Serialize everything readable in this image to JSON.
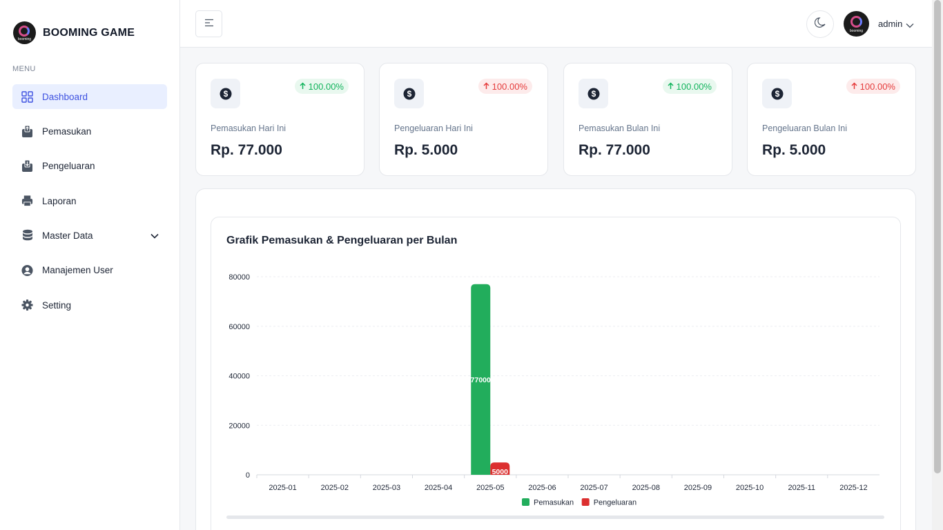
{
  "brand": {
    "name": "BOOMING GAME",
    "logo_text": "booming"
  },
  "sidebar": {
    "menu_title": "MENU",
    "items": [
      {
        "label": "Dashboard",
        "icon": "grid-icon",
        "active": true
      },
      {
        "label": "Pemasukan",
        "icon": "upload-box-icon"
      },
      {
        "label": "Pengeluaran",
        "icon": "download-box-icon"
      },
      {
        "label": "Laporan",
        "icon": "printer-icon"
      },
      {
        "label": "Master Data",
        "icon": "database-icon",
        "expandable": true
      },
      {
        "label": "Manajemen User",
        "icon": "user-circle-icon"
      },
      {
        "label": "Setting",
        "icon": "gear-icon"
      }
    ]
  },
  "header": {
    "user_name": "admin",
    "avatar_text": "booming"
  },
  "cards": [
    {
      "label": "Pemasukan Hari Ini",
      "value": "Rp. 77.000",
      "change": "100.00%",
      "trend": "up"
    },
    {
      "label": "Pengeluaran Hari Ini",
      "value": "Rp. 5.000",
      "change": "100.00%",
      "trend": "down"
    },
    {
      "label": "Pemasukan Bulan Ini",
      "value": "Rp. 77.000",
      "change": "100.00%",
      "trend": "up"
    },
    {
      "label": "Pengeluaran Bulan Ini",
      "value": "Rp. 5.000",
      "change": "100.00%",
      "trend": "down"
    }
  ],
  "colors": {
    "accent": "#3c50e0",
    "income": "#22ad5c",
    "expense": "#dc3030",
    "up": "#10b35b",
    "down": "#e53b3b"
  },
  "chart_data": {
    "type": "bar",
    "title": "Grafik Pemasukan & Pengeluaran per Bulan",
    "categories": [
      "2025-01",
      "2025-02",
      "2025-03",
      "2025-04",
      "2025-05",
      "2025-06",
      "2025-07",
      "2025-08",
      "2025-09",
      "2025-10",
      "2025-11",
      "2025-12"
    ],
    "series": [
      {
        "name": "Pemasukan",
        "color": "#22ad5c",
        "values": [
          0,
          0,
          0,
          0,
          77000,
          0,
          0,
          0,
          0,
          0,
          0,
          0
        ]
      },
      {
        "name": "Pengeluaran",
        "color": "#dc3030",
        "values": [
          0,
          0,
          0,
          0,
          5000,
          0,
          0,
          0,
          0,
          0,
          0,
          0
        ]
      }
    ],
    "yticks": [
      0,
      20000,
      40000,
      60000,
      80000
    ],
    "ylim": [
      0,
      80000
    ],
    "legend": "bottom",
    "grid": true
  }
}
